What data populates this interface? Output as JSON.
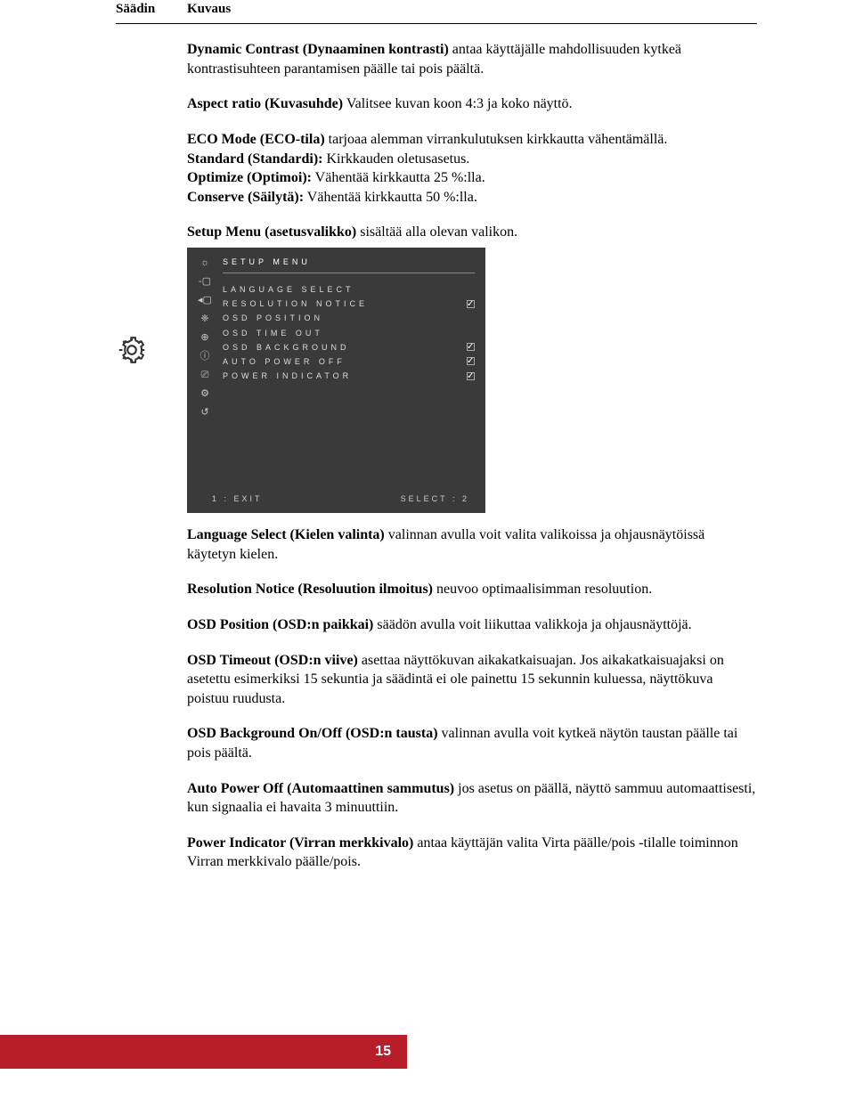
{
  "table": {
    "header_saadin": "Säädin",
    "header_kuvaus": "Kuvaus"
  },
  "paragraphs": {
    "p1_bold": "Dynamic Contrast (Dynaaminen kontrasti)",
    "p1_rest": " antaa käyttäjälle mahdollisuuden kytkeä kontrastisuhteen parantamisen päälle tai pois päältä.",
    "p2_bold": "Aspect ratio (Kuvasuhde)",
    "p2_rest": " Valitsee kuvan koon 4:3 ja koko näyttö.",
    "p3a_bold": "ECO Mode (ECO-tila)",
    "p3a_rest": " tarjoaa alemman virrankulutuksen kirkkautta vähentämällä.",
    "p3b_bold": "Standard (Standardi):",
    "p3b_rest": " Kirkkauden oletusasetus.",
    "p3c_bold": "Optimize (Optimoi):",
    "p3c_rest": " Vähentää kirkkautta 25 %:lla.",
    "p3d_bold": "Conserve (Säilytä):",
    "p3d_rest": " Vähentää kirkkautta 50 %:lla.",
    "p4_bold": "Setup Menu (asetusvalikko)",
    "p4_rest": " sisältää alla olevan valikon.",
    "p5_bold": "Language Select (Kielen valinta)",
    "p5_rest": " valinnan avulla voit valita valikoissa ja ohjausnäytöissä käytetyn kielen.",
    "p6_bold": "Resolution Notice (Resoluution ilmoitus)",
    "p6_rest": "  neuvoo optimaalisimman resoluution.",
    "p7_bold": "OSD Position (OSD:n paikkai)",
    "p7_rest": " säädön avulla voit liikuttaa valikkoja ja ohjausnäyttöjä.",
    "p8_bold": "OSD Timeout (OSD:n viive)",
    "p8_rest": " asettaa näyttökuvan aikakatkaisuajan. Jos aikakatkaisuajaksi on asetettu esimerkiksi 15 sekuntia ja säädintä ei ole painettu 15 sekunnin kuluessa, näyttökuva poistuu ruudusta.",
    "p9_bold": "OSD Background On/Off (OSD:n tausta)",
    "p9_rest": " valinnan avulla voit kytkeä näytön taustan päälle tai pois päältä.",
    "p10_bold": "Auto Power Off (Automaattinen sammutus)",
    "p10_rest": " jos asetus on päällä, näyttö sammuu automaattisesti, kun signaalia ei havaita 3 minuuttiin.",
    "p11_bold": "Power Indicator (Virran merkkivalo)",
    "p11_rest": " antaa käyttäjän valita Virta päälle/pois -tilalle toiminnon Virran merkkivalo päälle/pois."
  },
  "osd": {
    "title": "SETUP MENU",
    "items": [
      {
        "label": "LANGUAGE SELECT",
        "check": ""
      },
      {
        "label": "RESOLUTION NOTICE",
        "check": "checked"
      },
      {
        "label": "OSD POSITION",
        "check": ""
      },
      {
        "label": "OSD TIME OUT",
        "check": ""
      },
      {
        "label": "OSD BACKGROUND",
        "check": "checked"
      },
      {
        "label": "AUTO POWER OFF",
        "check": "checked"
      },
      {
        "label": "POWER INDICATOR",
        "check": "checked"
      }
    ],
    "footer_left": "1 : EXIT",
    "footer_right": "SELECT : 2"
  },
  "page_number": "15"
}
